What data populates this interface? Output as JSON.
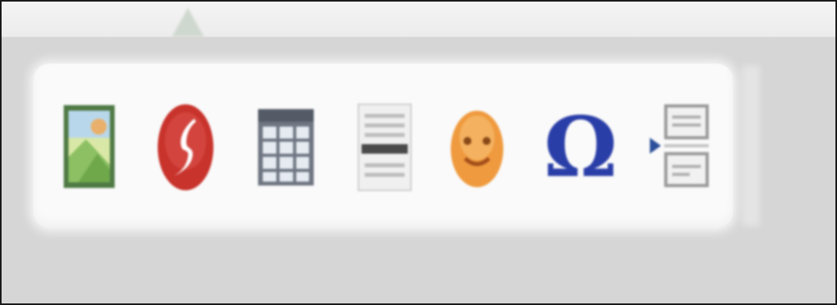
{
  "window": {
    "title": "",
    "toolbar": {
      "tools": [
        {
          "id": "image",
          "icon": "insert-image-icon",
          "tooltip": ""
        },
        {
          "id": "flash",
          "icon": "insert-flash-icon",
          "tooltip": ""
        },
        {
          "id": "table",
          "icon": "insert-table-icon",
          "tooltip": ""
        },
        {
          "id": "horizontal-rule",
          "icon": "horizontal-rule-icon",
          "tooltip": ""
        },
        {
          "id": "smiley",
          "icon": "insert-smiley-icon",
          "tooltip": ""
        },
        {
          "id": "special-char",
          "icon": "special-character-icon",
          "glyph": "Ω"
        },
        {
          "id": "page-break",
          "icon": "page-break-icon",
          "tooltip": ""
        }
      ]
    }
  },
  "colors": {
    "background": "#d6d6d6",
    "toolbar": "#fafafa",
    "flash_red": "#c8332c",
    "omega_blue": "#2a3ea8",
    "smiley_orange": "#ef9a3e"
  }
}
